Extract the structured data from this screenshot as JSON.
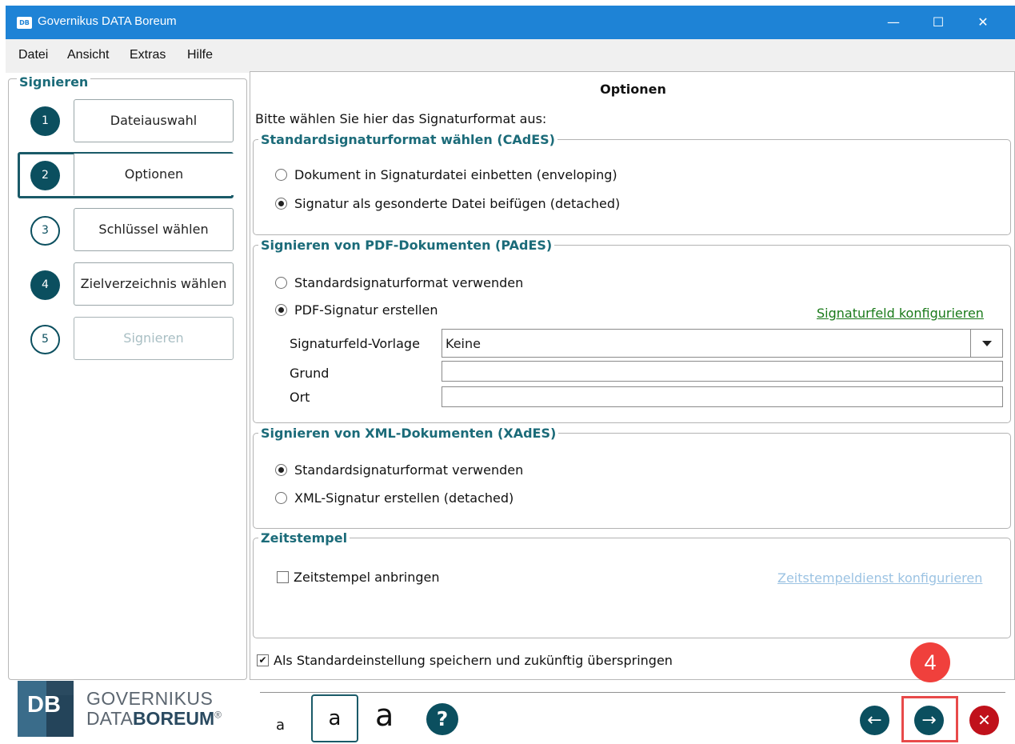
{
  "window": {
    "app_logo": "DB",
    "title": "Governikus DATA Boreum",
    "minimize": "—",
    "maximize": "☐",
    "close": "✕"
  },
  "menu": {
    "items": [
      "Datei",
      "Ansicht",
      "Extras",
      "Hilfe"
    ]
  },
  "sidebar": {
    "legend": "Signieren",
    "steps": [
      {
        "number": "1",
        "label": "Dateiauswahl",
        "state": "done"
      },
      {
        "number": "2",
        "label": "Optionen",
        "state": "active"
      },
      {
        "number": "3",
        "label": "Schlüssel wählen",
        "state": "pending"
      },
      {
        "number": "4",
        "label": "Zielverzeichnis wählen",
        "state": "done"
      },
      {
        "number": "5",
        "label": "Signieren",
        "state": "disabled"
      }
    ],
    "brand_logo": "DB",
    "brand_line1": "GOVERNIKUS",
    "brand_line2_a": "DATA",
    "brand_line2_b": "BOREUM",
    "brand_mark": "®"
  },
  "main": {
    "title": "Optionen",
    "intro": "Bitte wählen Sie hier das Signaturformat aus:",
    "cades": {
      "legend": "Standardsignaturformat wählen (CAdES)",
      "opt1": "Dokument in Signaturdatei einbetten (enveloping)",
      "opt2": "Signatur als gesonderte Datei beifügen (detached)",
      "selected": "opt2"
    },
    "pades": {
      "legend": "Signieren von PDF-Dokumenten (PAdES)",
      "opt1": "Standardsignaturformat verwenden",
      "opt2": "PDF-Signatur erstellen",
      "selected": "opt2",
      "config_link": "Signaturfeld konfigurieren",
      "template_label": "Signaturfeld-Vorlage",
      "template_value": "Keine",
      "reason_label": "Grund",
      "reason_value": "",
      "location_label": "Ort",
      "location_value": ""
    },
    "xades": {
      "legend": "Signieren von XML-Dokumenten (XAdES)",
      "opt1": "Standardsignaturformat verwenden",
      "opt2": "XML-Signatur erstellen (detached)",
      "selected": "opt1"
    },
    "timestamp": {
      "legend": "Zeitstempel",
      "checkbox": "Zeitstempel anbringen",
      "checked": false,
      "config_link": "Zeitstempeldienst konfigurieren"
    },
    "save_default": {
      "label": "Als Standardeinstellung speichern und zukünftig überspringen",
      "checked": true
    }
  },
  "toolbar": {
    "font_small": "a",
    "font_medium": "a",
    "font_large": "a",
    "help": "?",
    "back": "←",
    "next": "→",
    "cancel": "✕"
  },
  "annotation": {
    "badge": "4",
    "highlight_color": "#e84a4a"
  },
  "colors": {
    "accent": "#0b4f5f",
    "legend_text": "#1b6b79",
    "link_green": "#1a7a1a",
    "link_disabled": "#9cc3e3",
    "cancel_red": "#c0111b",
    "titlebar": "#1e83d6"
  }
}
